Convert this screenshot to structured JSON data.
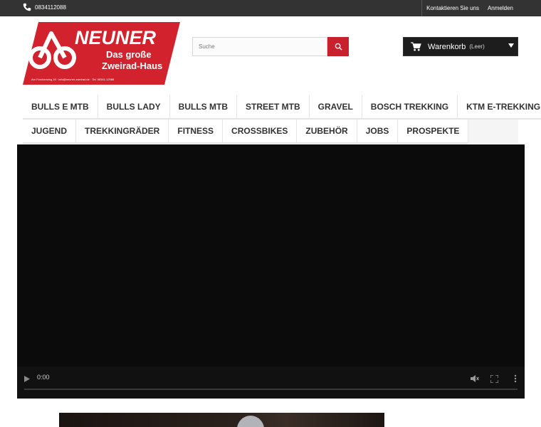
{
  "topbar": {
    "phone": "0834112088",
    "contact_label": "Kontaktieren Sie uns",
    "login_label": "Anmelden"
  },
  "logo": {
    "brand": "NEUNER",
    "tagline_1": "Das große",
    "tagline_2": "Zweirad-Haus",
    "address_line": "Am Forchenweg 16 · info@neuner-zweirad.de · Tel. 08341-12088"
  },
  "search": {
    "placeholder": "Suche"
  },
  "cart": {
    "label": "Warenkorb",
    "status": "(Leer)"
  },
  "menu": {
    "row1": [
      "BULLS E MTB",
      "BULLS LADY",
      "BULLS MTB",
      "STREET MTB",
      "GRAVEL",
      "BOSCH TREKKING",
      "KTM E-TREKKING"
    ],
    "row2": [
      "JUGEND",
      "TREKKINGRÄDER",
      "FITNESS",
      "CROSSBIKES",
      "ZUBEHÖR",
      "JOBS",
      "PROSPEKTE"
    ]
  },
  "video": {
    "time": "0:00"
  },
  "colors": {
    "topbar": "#333333",
    "accent": "#c8202d",
    "cart": "#1d1d1d"
  }
}
